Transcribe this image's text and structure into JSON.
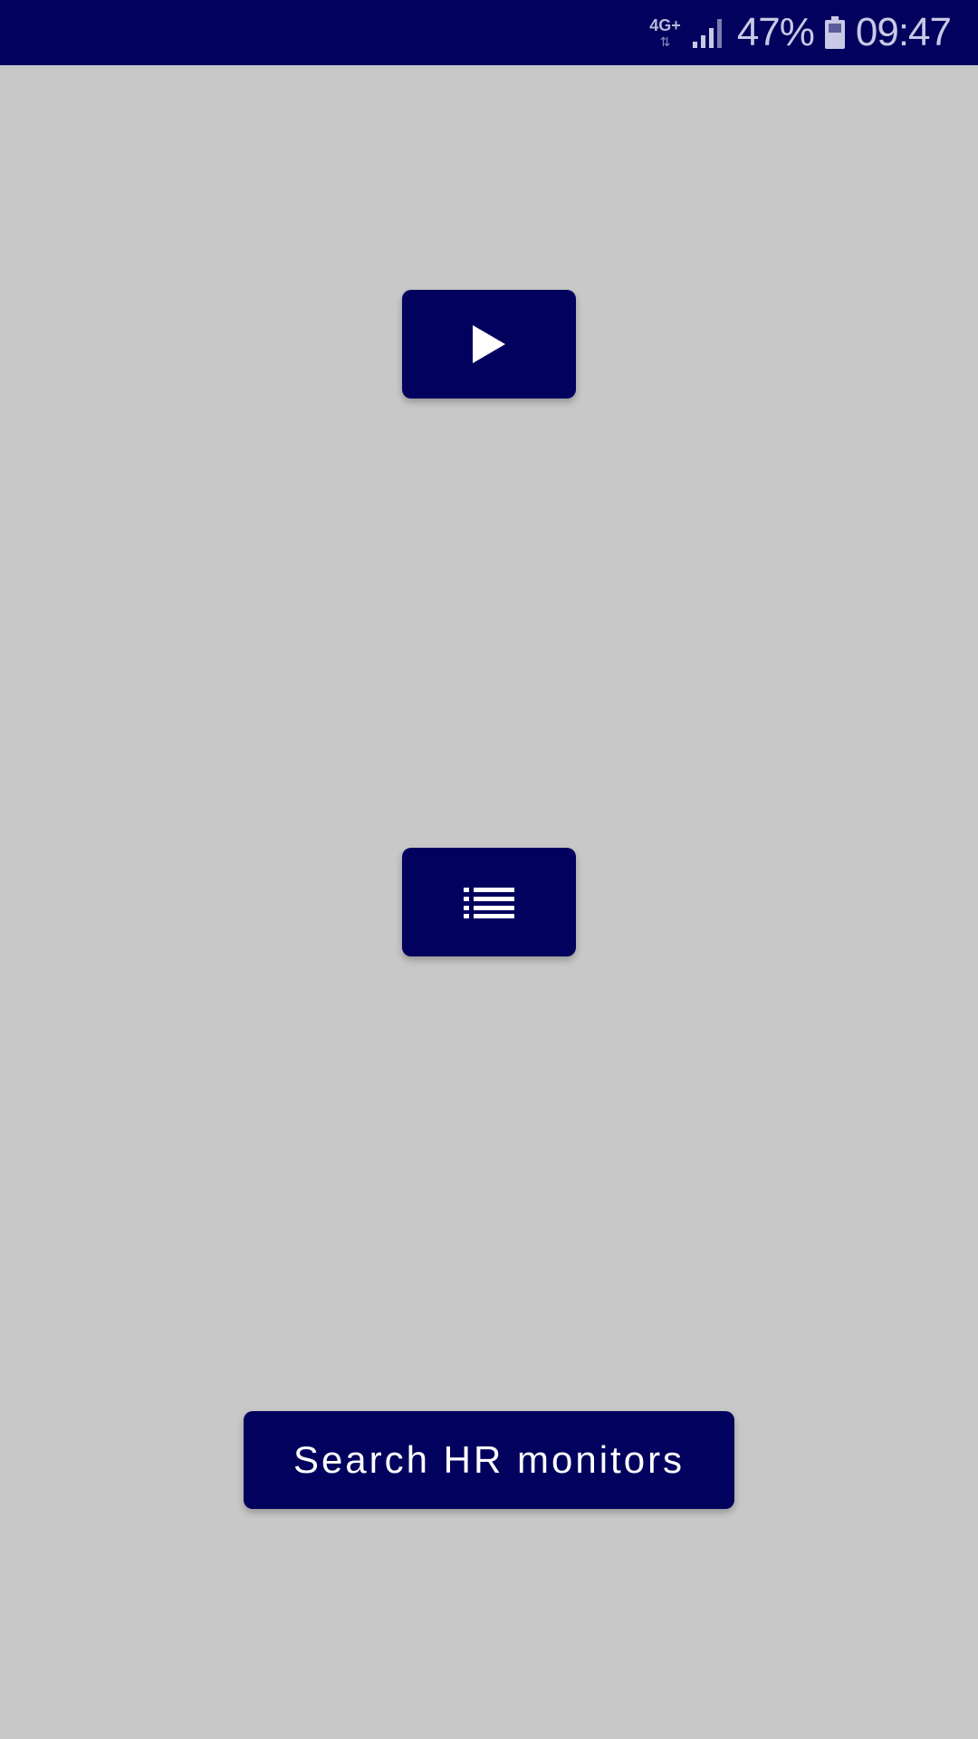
{
  "status_bar": {
    "network_type": "4G+",
    "battery_percent": "47%",
    "time": "09:47",
    "signal_icon": "signal-bars-icon",
    "battery_icon": "battery-icon",
    "background_color": "#02015e"
  },
  "main": {
    "play_button": {
      "icon": "play-icon"
    },
    "list_button": {
      "icon": "list-icon"
    },
    "search_button": {
      "label": "Search HR monitors"
    },
    "accent_color": "#02015e",
    "background_color": "#c8c8c8"
  }
}
